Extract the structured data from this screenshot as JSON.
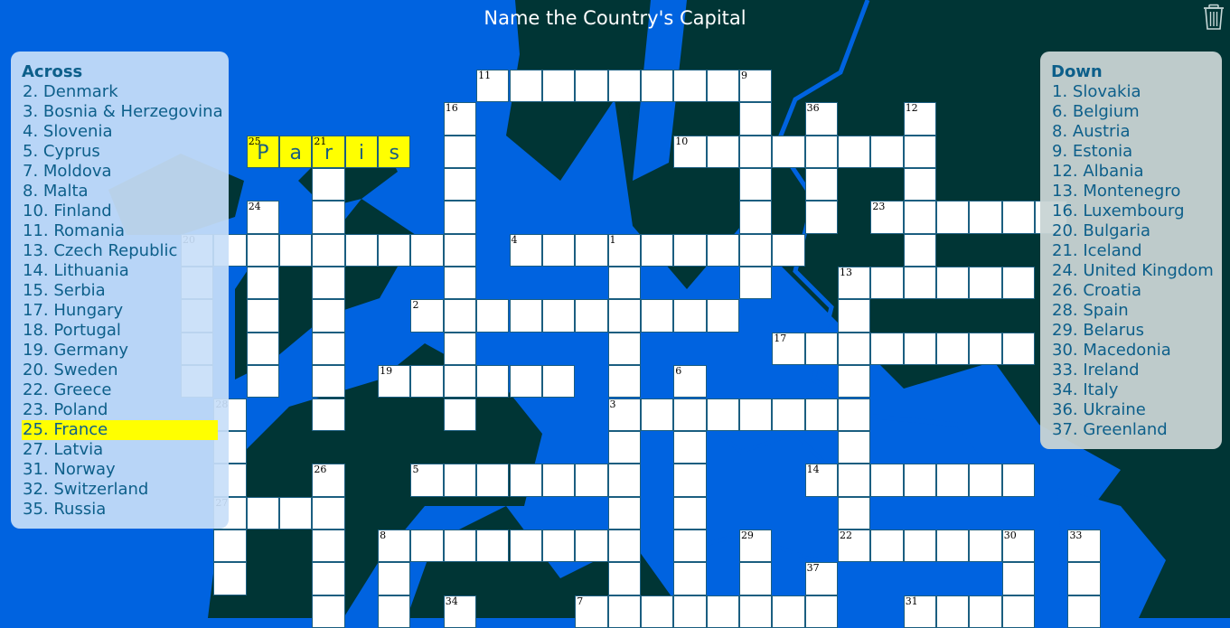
{
  "title": "Name the Country's Capital",
  "icons": {
    "trash": "trash-icon"
  },
  "colors": {
    "sea": "#0063e0",
    "land": "#003535",
    "highlight": "#ffff00",
    "clue_text": "#0d5f8a",
    "cell_border": "#1b5e80"
  },
  "across": {
    "heading": "Across",
    "clues": [
      {
        "label": "2. Denmark"
      },
      {
        "label": "3. Bosnia & Herzegovina"
      },
      {
        "label": "4. Slovenia"
      },
      {
        "label": "5. Cyprus"
      },
      {
        "label": "7. Moldova"
      },
      {
        "label": "8. Malta"
      },
      {
        "label": "10. Finland"
      },
      {
        "label": "11. Romania"
      },
      {
        "label": "13. Czech Republic"
      },
      {
        "label": "14. Lithuania"
      },
      {
        "label": "15. Serbia"
      },
      {
        "label": "17. Hungary"
      },
      {
        "label": "18. Portugal"
      },
      {
        "label": "19. Germany"
      },
      {
        "label": "20. Sweden"
      },
      {
        "label": "22. Greece"
      },
      {
        "label": "23. Poland"
      },
      {
        "label": "25. France",
        "active": true
      },
      {
        "label": "27. Latvia"
      },
      {
        "label": "31. Norway"
      },
      {
        "label": "32. Switzerland"
      },
      {
        "label": "35. Russia"
      }
    ]
  },
  "down": {
    "heading": "Down",
    "clues": [
      {
        "label": "1. Slovakia"
      },
      {
        "label": "6. Belgium"
      },
      {
        "label": "8. Austria"
      },
      {
        "label": "9. Estonia"
      },
      {
        "label": "12. Albania"
      },
      {
        "label": "13. Montenegro"
      },
      {
        "label": "16. Luxembourg"
      },
      {
        "label": "20. Bulgaria"
      },
      {
        "label": "21. Iceland"
      },
      {
        "label": "24. United Kingdom"
      },
      {
        "label": "26. Croatia"
      },
      {
        "label": "28. Spain"
      },
      {
        "label": "29. Belarus"
      },
      {
        "label": "30. Macedonia"
      },
      {
        "label": "33. Ireland"
      },
      {
        "label": "34. Italy"
      },
      {
        "label": "36. Ukraine"
      },
      {
        "label": "37. Greenland"
      }
    ]
  },
  "grid": {
    "rows": [
      {
        "r": 0,
        "cols": [
          9,
          10,
          11,
          12,
          13,
          14,
          15,
          16,
          17
        ]
      },
      {
        "r": 1,
        "cols": [
          8,
          17,
          19,
          22
        ]
      },
      {
        "r": 2,
        "cols": [
          2,
          3,
          4,
          5,
          6,
          8,
          15,
          16,
          17,
          18,
          19,
          20,
          21,
          22
        ]
      },
      {
        "r": 3,
        "cols": [
          4,
          8,
          17,
          19,
          22
        ]
      },
      {
        "r": 4,
        "cols": [
          2,
          4,
          8,
          17,
          19,
          21,
          22,
          23,
          24,
          25,
          26
        ]
      },
      {
        "r": 5,
        "cols": [
          0,
          1,
          2,
          3,
          4,
          5,
          6,
          7,
          8,
          10,
          11,
          12,
          13,
          14,
          15,
          16,
          17,
          18,
          22
        ]
      },
      {
        "r": 6,
        "cols": [
          0,
          2,
          4,
          8,
          13,
          17,
          20,
          21,
          22,
          23,
          24,
          25
        ]
      },
      {
        "r": 7,
        "cols": [
          0,
          2,
          4,
          7,
          8,
          9,
          10,
          11,
          12,
          13,
          14,
          15,
          16,
          20
        ]
      },
      {
        "r": 8,
        "cols": [
          0,
          2,
          4,
          8,
          13,
          18,
          19,
          20,
          21,
          22,
          23,
          24,
          25
        ]
      },
      {
        "r": 9,
        "cols": [
          0,
          2,
          4,
          6,
          7,
          8,
          9,
          10,
          11,
          13,
          15,
          20
        ]
      },
      {
        "r": 10,
        "cols": [
          1,
          4,
          8,
          13,
          14,
          15,
          16,
          17,
          18,
          19,
          20
        ]
      },
      {
        "r": 11,
        "cols": [
          1,
          13,
          15,
          20
        ]
      },
      {
        "r": 12,
        "cols": [
          1,
          4,
          7,
          8,
          9,
          10,
          11,
          12,
          13,
          15,
          19,
          20,
          21,
          22,
          23,
          24,
          25
        ]
      },
      {
        "r": 13,
        "cols": [
          1,
          2,
          3,
          4,
          13,
          15,
          20
        ]
      },
      {
        "r": 14,
        "cols": [
          1,
          4,
          6,
          7,
          8,
          9,
          10,
          11,
          12,
          13,
          15,
          17,
          20,
          21,
          22,
          23,
          24,
          25,
          27
        ]
      },
      {
        "r": 15,
        "cols": [
          1,
          4,
          6,
          13,
          15,
          17,
          19,
          25,
          27
        ]
      },
      {
        "r": 16,
        "cols": [
          4,
          6,
          8,
          12,
          13,
          14,
          15,
          16,
          17,
          18,
          19,
          22,
          23,
          24,
          25,
          27
        ]
      }
    ],
    "numbers": [
      {
        "n": "11",
        "r": 0,
        "c": 9
      },
      {
        "n": "9",
        "r": 0,
        "c": 17
      },
      {
        "n": "16",
        "r": 1,
        "c": 8
      },
      {
        "n": "36",
        "r": 1,
        "c": 19
      },
      {
        "n": "12",
        "r": 1,
        "c": 22
      },
      {
        "n": "25",
        "r": 2,
        "c": 2
      },
      {
        "n": "21",
        "r": 2,
        "c": 4
      },
      {
        "n": "10",
        "r": 2,
        "c": 15
      },
      {
        "n": "24",
        "r": 4,
        "c": 2
      },
      {
        "n": "23",
        "r": 4,
        "c": 21
      },
      {
        "n": "20",
        "r": 5,
        "c": 0
      },
      {
        "n": "4",
        "r": 5,
        "c": 10
      },
      {
        "n": "1",
        "r": 5,
        "c": 13
      },
      {
        "n": "13",
        "r": 6,
        "c": 20
      },
      {
        "n": "2",
        "r": 7,
        "c": 7
      },
      {
        "n": "17",
        "r": 8,
        "c": 18
      },
      {
        "n": "19",
        "r": 9,
        "c": 6
      },
      {
        "n": "6",
        "r": 9,
        "c": 15
      },
      {
        "n": "28",
        "r": 10,
        "c": 1
      },
      {
        "n": "3",
        "r": 10,
        "c": 13
      },
      {
        "n": "26",
        "r": 12,
        "c": 4
      },
      {
        "n": "5",
        "r": 12,
        "c": 7
      },
      {
        "n": "14",
        "r": 12,
        "c": 19
      },
      {
        "n": "27",
        "r": 13,
        "c": 1
      },
      {
        "n": "8",
        "r": 14,
        "c": 6
      },
      {
        "n": "29",
        "r": 14,
        "c": 17
      },
      {
        "n": "22",
        "r": 14,
        "c": 20
      },
      {
        "n": "30",
        "r": 14,
        "c": 25
      },
      {
        "n": "33",
        "r": 14,
        "c": 27
      },
      {
        "n": "37",
        "r": 15,
        "c": 19
      },
      {
        "n": "34",
        "r": 16,
        "c": 8
      },
      {
        "n": "7",
        "r": 16,
        "c": 12
      },
      {
        "n": "31",
        "r": 16,
        "c": 22
      }
    ],
    "highlighted_word": {
      "r": 2,
      "c_start": 2,
      "answer": "Paris",
      "letters": [
        "P",
        "a",
        "r",
        "i",
        "s"
      ]
    }
  }
}
